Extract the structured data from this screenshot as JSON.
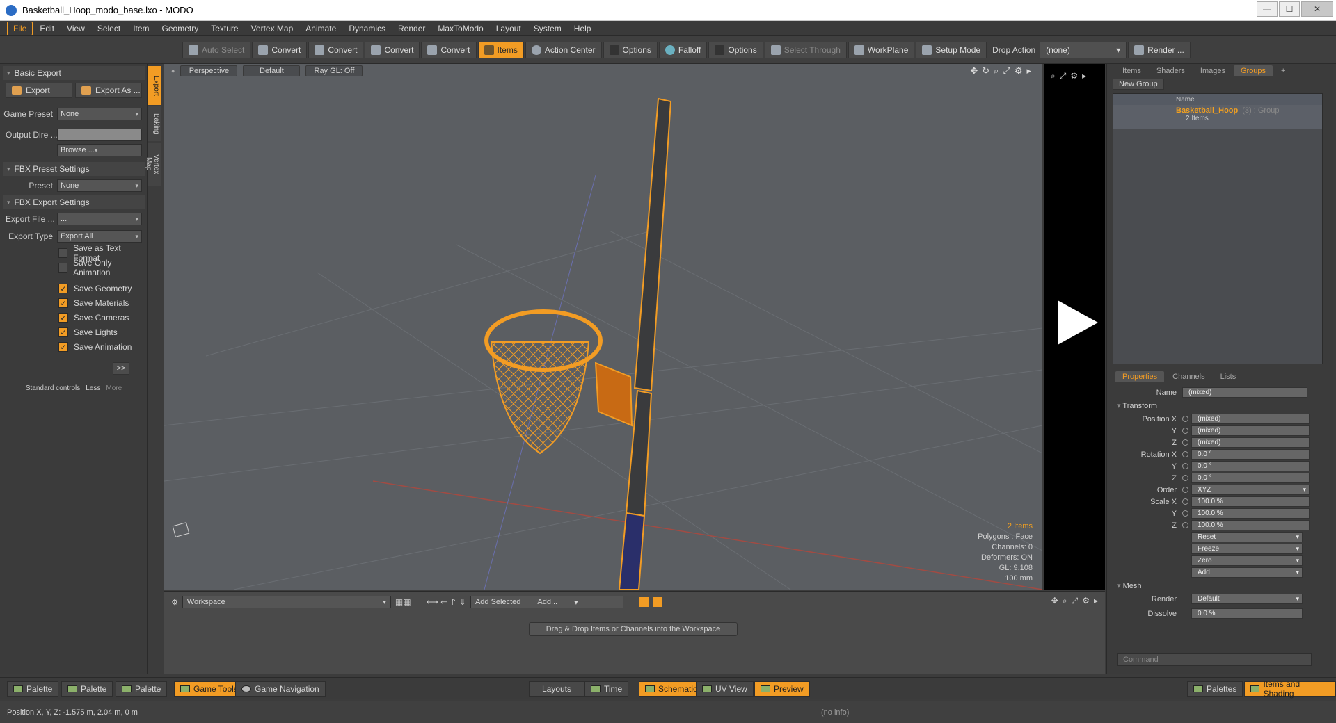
{
  "window": {
    "title": "Basketball_Hoop_modo_base.lxo - MODO"
  },
  "menu": [
    "File",
    "Edit",
    "View",
    "Select",
    "Item",
    "Geometry",
    "Texture",
    "Vertex Map",
    "Animate",
    "Dynamics",
    "Render",
    "MaxToModo",
    "Layout",
    "System",
    "Help"
  ],
  "toolbar": {
    "auto_select": "Auto Select",
    "convert": "Convert",
    "items": "Items",
    "action_center": "Action Center",
    "options": "Options",
    "falloff": "Falloff",
    "select_through": "Select Through",
    "workplane": "WorkPlane",
    "setup_mode": "Setup Mode",
    "drop_action": "Drop Action",
    "drop_value": "(none)",
    "render": "Render ..."
  },
  "left": {
    "basic_export": "Basic Export",
    "export": "Export",
    "export_as": "Export As ...",
    "game_preset_label": "Game Preset",
    "game_preset_value": "None",
    "output_dir_label": "Output Dire ...",
    "browse": "Browse ...",
    "fbx_preset_settings": "FBX Preset Settings",
    "preset_label": "Preset",
    "preset_value": "None",
    "fbx_export_settings": "FBX Export Settings",
    "export_file_label": "Export File ...",
    "export_file_value": "...",
    "export_type_label": "Export Type",
    "export_type_value": "Export All",
    "checks": [
      {
        "label": "Save as Text Format",
        "on": false
      },
      {
        "label": "Save Only Animation",
        "on": false
      },
      {
        "label": "Save Geometry",
        "on": true
      },
      {
        "label": "Save Materials",
        "on": true
      },
      {
        "label": "Save Cameras",
        "on": true
      },
      {
        "label": "Save Lights",
        "on": true
      },
      {
        "label": "Save Animation",
        "on": true
      }
    ],
    "more_btn": ">>",
    "std_controls": "Standard controls",
    "less": "Less",
    "more": "More",
    "vtabs": [
      "Export",
      "Baking",
      "Vertex Map"
    ]
  },
  "viewport": {
    "view": "Perspective",
    "shading": "Default",
    "raygl": "Ray GL: Off",
    "stats": {
      "items": "2 Items",
      "polygons": "Polygons : Face",
      "channels": "Channels: 0",
      "deformers": "Deformers: ON",
      "gl": "GL: 9,108",
      "unit": "100 mm"
    }
  },
  "right": {
    "tabs": [
      "Items",
      "Shaders",
      "Images",
      "Groups"
    ],
    "new_group": "New Group",
    "col_name": "Name",
    "group_name": "Basketball_Hoop",
    "group_meta": "(3) : Group",
    "group_sub": "2 Items",
    "prop_tabs": [
      "Properties",
      "Channels",
      "Lists"
    ],
    "name_label": "Name",
    "name_value": "(mixed)",
    "transform": "Transform",
    "position_x": "Position X",
    "rotation_x": "Rotation X",
    "scale_x": "Scale X",
    "y": "Y",
    "z": "Z",
    "order": "Order",
    "mixed": "(mixed)",
    "zero_deg": "0.0 °",
    "order_value": "XYZ",
    "hundred": "100.0 %",
    "reset": "Reset",
    "freeze": "Freeze",
    "zero": "Zero",
    "add": "Add",
    "mesh": "Mesh",
    "render_label": "Render",
    "render_value": "Default",
    "dissolve_label": "Dissolve",
    "dissolve_value": "0.0 %",
    "command": "Command"
  },
  "workspace": {
    "workspace": "Workspace",
    "add_selected": "Add Selected",
    "add": "Add...",
    "drag_msg": "Drag & Drop Items or Channels into the Workspace"
  },
  "bottom": {
    "palette": "Palette",
    "game_tools": "Game Tools",
    "game_navigation": "Game Navigation",
    "layouts": "Layouts",
    "time": "Time",
    "schematic": "Schematic",
    "uv_view": "UV View",
    "preview": "Preview",
    "palettes": "Palettes",
    "items_shading": "Items and Shading"
  },
  "status": {
    "position": "Position X, Y, Z:   -1.575 m, 2.04 m, 0 m",
    "info": "(no info)"
  },
  "colors": {
    "accent": "#f29c24"
  }
}
